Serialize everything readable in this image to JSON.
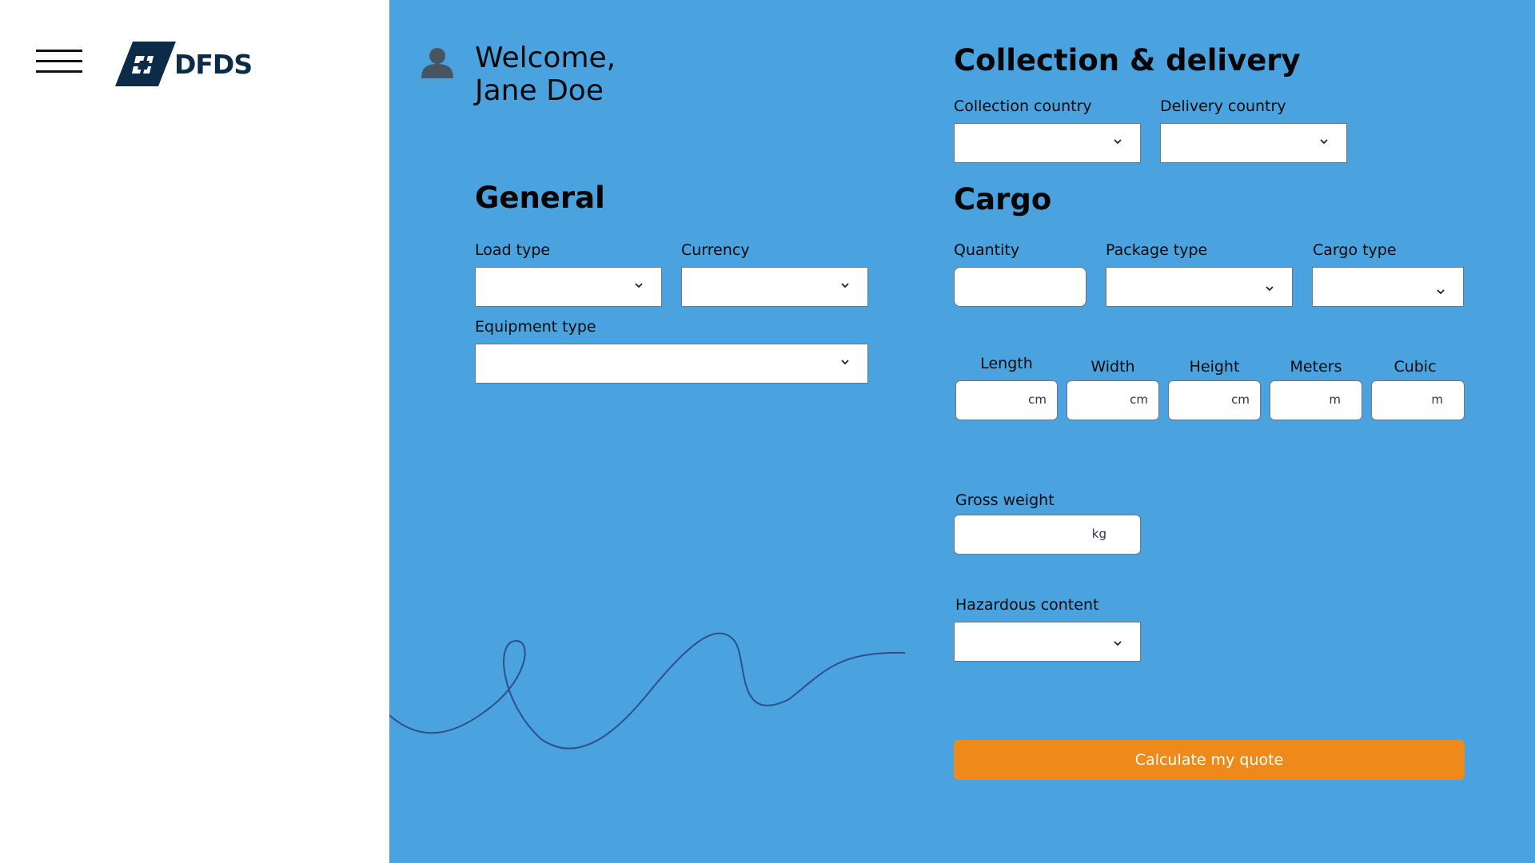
{
  "brand": {
    "logo_text": "DFDS",
    "logo_color": "#0c2b48"
  },
  "colors": {
    "panel": "#4aa3df",
    "button": "#ee8a1a"
  },
  "user": {
    "greeting": "Welcome,",
    "name": "Jane Doe",
    "icon": "user-icon"
  },
  "general": {
    "heading": "General",
    "load_type_label": "Load type",
    "currency_label": "Currency",
    "equipment_type_label": "Equipment type"
  },
  "collection": {
    "heading": "Collection & delivery",
    "collection_country_label": "Collection country",
    "delivery_country_label": "Delivery country"
  },
  "cargo": {
    "heading": "Cargo",
    "quantity_label": "Quantity",
    "package_type_label": "Package type",
    "cargo_type_label": "Cargo type",
    "dimensions": [
      {
        "label": "Length",
        "unit": "cm"
      },
      {
        "label": "Width",
        "unit": "cm"
      },
      {
        "label": "Height",
        "unit": "cm"
      },
      {
        "label": "Meters",
        "unit": "m"
      },
      {
        "label": "Cubic",
        "unit": "m"
      }
    ],
    "gross_weight_label": "Gross weight",
    "gross_weight_unit": "kg",
    "hazardous_label": "Hazardous content"
  },
  "actions": {
    "calculate_label": "Calculate my quote"
  }
}
